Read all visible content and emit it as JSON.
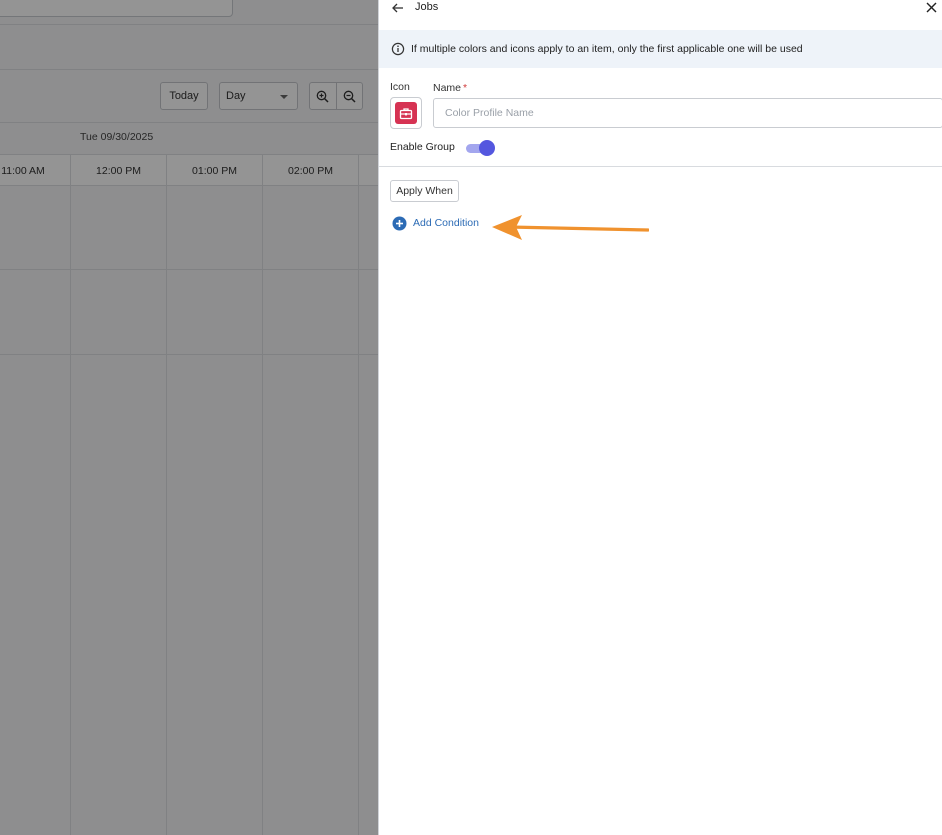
{
  "background_calendar": {
    "today_label": "Today",
    "view_select": "Day",
    "date_label": "Tue 09/30/2025",
    "time_slots": [
      "11:00 AM",
      "12:00 PM",
      "01:00 PM",
      "02:00 PM"
    ]
  },
  "drawer": {
    "title": "Jobs",
    "info_message": "If multiple colors and icons apply to an item, only the first applicable one will be used",
    "icon_label": "Icon",
    "name_label": "Name",
    "name_required_marker": "*",
    "name_placeholder": "Color Profile Name",
    "name_value": "",
    "enable_group_label": "Enable Group",
    "enable_group_on": true,
    "apply_when_label": "Apply When",
    "add_condition_label": "Add Condition",
    "icon_color": "#d63353",
    "accent_color": "#5457df",
    "link_color": "#2c6bb5",
    "annotation_arrow_color": "#f0922e"
  }
}
